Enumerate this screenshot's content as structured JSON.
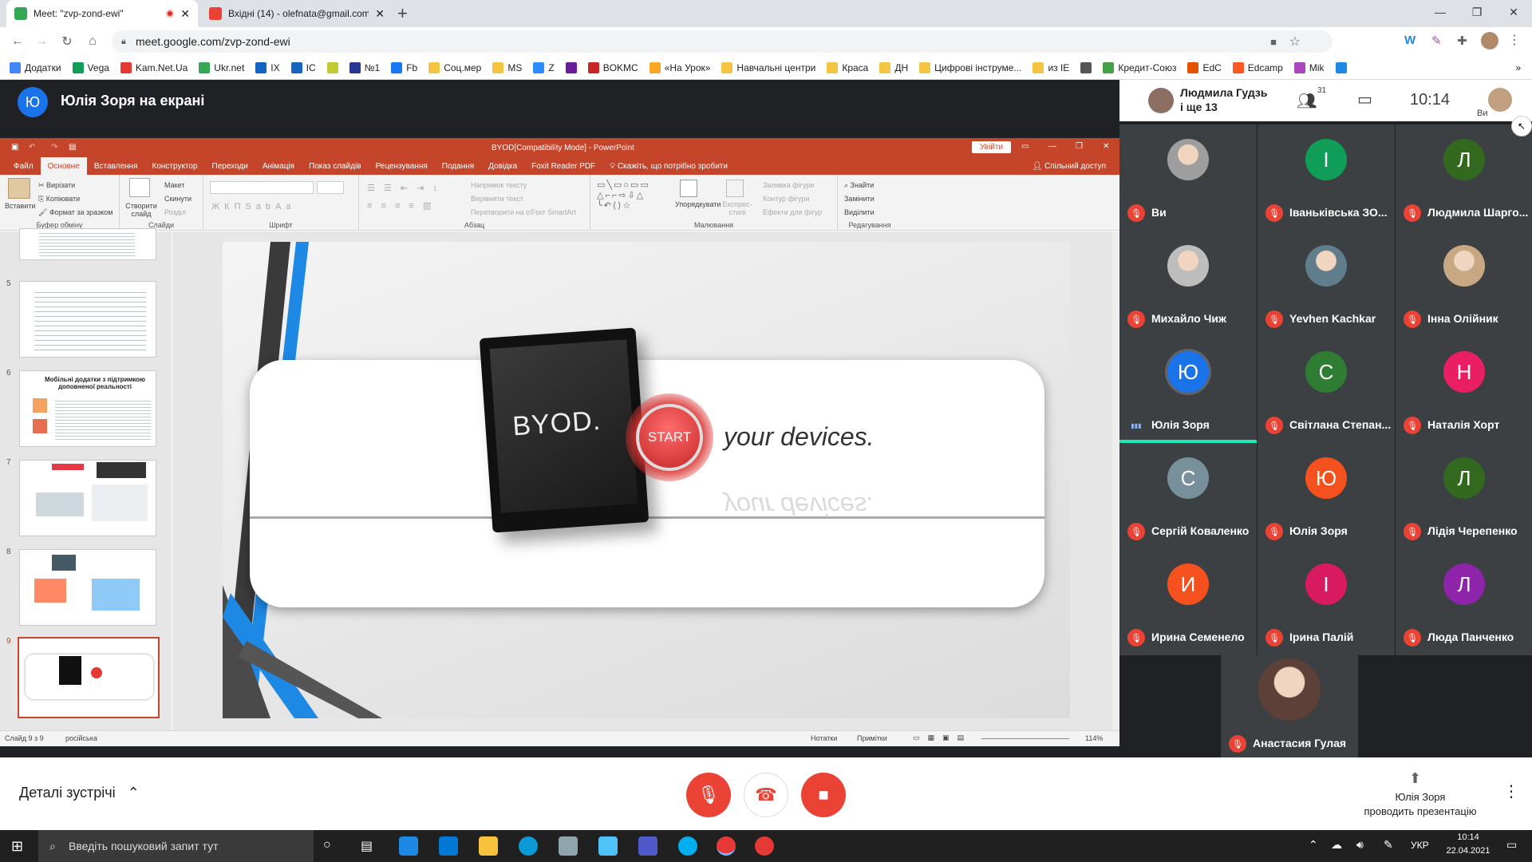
{
  "browser": {
    "tabs": [
      {
        "title": "Meet: \"zvp-zond-ewi\"",
        "favicon_color": "#34a853",
        "recording": true
      },
      {
        "title": "Вхідні (14) - olefnata@gmail.com",
        "favicon_color": "#ea4335"
      }
    ],
    "new_tab": "+",
    "url": "meet.google.com/zvp-zond-ewi",
    "bookmarks": [
      {
        "label": "Додатки",
        "color": "#4285f4"
      },
      {
        "label": "Vega",
        "color": "#0f9d58"
      },
      {
        "label": "Kam.Net.Ua",
        "color": "#e53935"
      },
      {
        "label": "Ukr.net",
        "color": "#34a853"
      },
      {
        "label": "IX",
        "color": "#1565c0"
      },
      {
        "label": "IC",
        "color": "#1565c0"
      },
      {
        "label": "",
        "color": "#c0ca33"
      },
      {
        "label": "№1",
        "color": "#283593"
      },
      {
        "label": "Fb",
        "color": "#1877f2"
      },
      {
        "label": "Соц.мер",
        "color": "#f4c542"
      },
      {
        "label": "MS",
        "color": "#f4c542"
      },
      {
        "label": "Z",
        "color": "#2d8cff"
      },
      {
        "label": "",
        "color": "#6a1b9a"
      },
      {
        "label": "BOKMC",
        "color": "#c62828"
      },
      {
        "label": "«На Урок»",
        "color": "#f9a825"
      },
      {
        "label": "Навчальні центри",
        "color": "#f4c542"
      },
      {
        "label": "Краса",
        "color": "#f4c542"
      },
      {
        "label": "ДН",
        "color": "#f4c542"
      },
      {
        "label": "Цифрові інструме...",
        "color": "#f4c542"
      },
      {
        "label": "из IE",
        "color": "#f4c542"
      },
      {
        "label": "",
        "color": "#555555"
      },
      {
        "label": "Кредит-Союз",
        "color": "#43a047"
      },
      {
        "label": "EdC",
        "color": "#e65100"
      },
      {
        "label": "Edcamp",
        "color": "#ff5722"
      },
      {
        "label": "Mik",
        "color": "#ab47bc"
      },
      {
        "label": "",
        "color": "#1e88e5"
      }
    ]
  },
  "meet": {
    "presenter_initial": "Ю",
    "presenter_title": "Юлія Зоря на екрані",
    "top_right": {
      "name": "Людмила Гудзь",
      "and_more": "і ще 13",
      "participants_count": "31",
      "time": "10:14",
      "self_label": "Ви"
    },
    "participants": [
      {
        "name": "Ви",
        "initial": "",
        "avatar_color": "#9e9e9e",
        "photo": true
      },
      {
        "name": "Іваньківська ЗО...",
        "initial": "І",
        "avatar_color": "#0f9d58"
      },
      {
        "name": "Людмила Шарго...",
        "initial": "Л",
        "avatar_color": "#33691e"
      },
      {
        "name": "Михайло Чиж",
        "initial": "",
        "avatar_color": "#bdbdbd",
        "photo": true
      },
      {
        "name": "Yevhen Kachkar",
        "initial": "",
        "avatar_color": "#607d8b",
        "photo": true
      },
      {
        "name": "Інна Олійник",
        "initial": "",
        "avatar_color": "#c8a882",
        "photo": true
      },
      {
        "name": "Юлія Зоря",
        "initial": "Ю",
        "avatar_color": "#1a73e8",
        "speaking": true
      },
      {
        "name": "Світлана Степан...",
        "initial": "С",
        "avatar_color": "#2e7d32"
      },
      {
        "name": "Наталія Хорт",
        "initial": "Н",
        "avatar_color": "#e91e63"
      },
      {
        "name": "Сергій Коваленко",
        "initial": "С",
        "avatar_color": "#78909c"
      },
      {
        "name": "Юлія Зоря",
        "initial": "Ю",
        "avatar_color": "#f4511e"
      },
      {
        "name": "Лідія Черепенко",
        "initial": "Л",
        "avatar_color": "#33691e"
      },
      {
        "name": "Ирина Семенело",
        "initial": "И",
        "avatar_color": "#f4511e"
      },
      {
        "name": "Ірина Палій",
        "initial": "І",
        "avatar_color": "#d81b60"
      },
      {
        "name": "Люда Панченко",
        "initial": "Л",
        "avatar_color": "#8e24aa"
      },
      {
        "name": "Анастасия Гулая",
        "initial": "",
        "avatar_color": "#5d4037",
        "photo": true
      }
    ],
    "bottom": {
      "meeting_details": "Деталі зустрічі",
      "presenting_line1": "Юлія Зоря",
      "presenting_line2": "проводить презентацію"
    },
    "accent": "#ea4335"
  },
  "ppt": {
    "title": "BYOD[Compatibility Mode] - PowerPoint",
    "signin": "Увійти",
    "tabs": [
      "Файл",
      "Основне",
      "Вставлення",
      "Конструктор",
      "Переходи",
      "Анімація",
      "Показ слайдів",
      "Рецензування",
      "Подання",
      "Довідка",
      "Foxit Reader PDF"
    ],
    "tell_me": "Скажіть, що потрібно зробити",
    "share": "Спільний доступ",
    "ribbon": {
      "paste": "Вставити",
      "cut": "Вирізати",
      "copy": "Копіювати",
      "format_painter": "Формат за зразком",
      "clipboard": "Буфер обміну",
      "new_slide": "Створити слайд",
      "layout": "Макет",
      "reset": "Скинути",
      "section": "Розділ",
      "slides": "Слайди",
      "font": "Шрифт",
      "text_direction": "Напрямок тексту",
      "align_text": "Вирівняти текст",
      "smartart": "Перетворити на об'єкт SmartArt",
      "paragraph": "Абзац",
      "arrange": "Упорядкувати",
      "quick_styles": "Експрес-стилі",
      "shape_fill": "Заливка фігури",
      "shape_outline": "Контур фігури",
      "shape_effects": "Ефекти для фігур",
      "drawing": "Малювання",
      "find": "Знайти",
      "replace": "Замінити",
      "select": "Виділити",
      "editing": "Редагування"
    },
    "thumbnails": [
      {
        "num": "5",
        "kind": "table"
      },
      {
        "num": "6",
        "kind": "apps",
        "title": "Мобільні додатки з підтримкою доповненої реальності"
      },
      {
        "num": "7",
        "kind": "collage"
      },
      {
        "num": "8",
        "kind": "collage"
      },
      {
        "num": "9",
        "kind": "byod",
        "selected": true
      }
    ],
    "slide": {
      "tablet_text": "BYOD.",
      "button_text": "START",
      "tagline": "your devices."
    },
    "status": {
      "slide_info": "Слайд 9 з 9",
      "language": "російська",
      "notes": "Нотатки",
      "comments": "Примітки",
      "zoom": "114%"
    }
  },
  "taskbar": {
    "search_placeholder": "Введіть пошуковий запит тут",
    "lang": "УКР",
    "time": "10:14",
    "date": "22.04.2021"
  }
}
